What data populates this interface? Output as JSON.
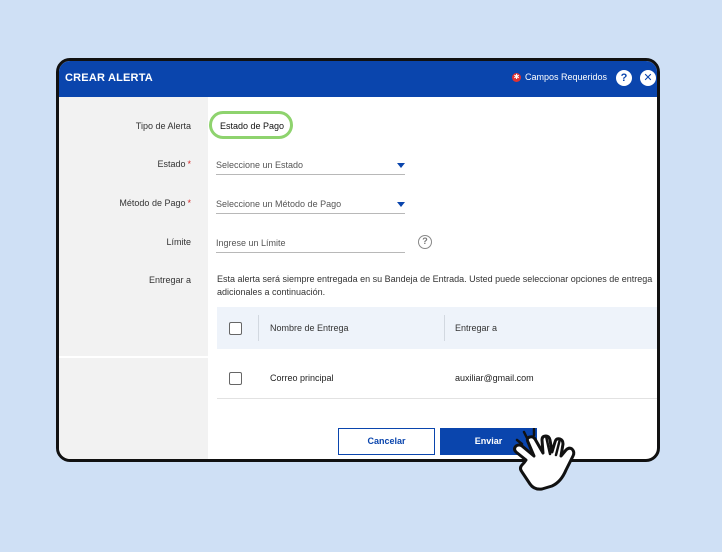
{
  "header": {
    "title": "CREAR ALERTA",
    "required_label": "Campos Requeridos",
    "help_label": "?",
    "close_label": "✕"
  },
  "form": {
    "alert_type": {
      "label": "Tipo de Alerta",
      "value": "Estado de Pago"
    },
    "state": {
      "label": "Estado",
      "required_mark": "*",
      "placeholder": "Seleccione un Estado"
    },
    "payment_method": {
      "label": "Método de Pago",
      "required_mark": "*",
      "placeholder": "Seleccione un Método de Pago"
    },
    "limit": {
      "label": "Límite",
      "placeholder": "Ingrese un Límite",
      "help_icon": "?"
    },
    "deliver_to": {
      "label": "Entregar a",
      "info": "Esta alerta será siempre entregada en su Bandeja de Entrada. Usted puede seleccionar opciones de entrega adicionales a continuación."
    }
  },
  "table": {
    "columns": [
      "Nombre de Entrega",
      "Entregar a"
    ],
    "rows": [
      {
        "name": "Correo principal",
        "target": "auxiliar@gmail.com"
      }
    ]
  },
  "actions": {
    "cancel": "Cancelar",
    "send": "Enviar"
  },
  "colors": {
    "brand": "#0a45ad",
    "required": "#d62828",
    "highlight": "#8ed36e",
    "background": "#cfe0f5"
  },
  "icons": {
    "cursor": "pointer-hand-icon",
    "required": "required-asterisk-icon"
  }
}
